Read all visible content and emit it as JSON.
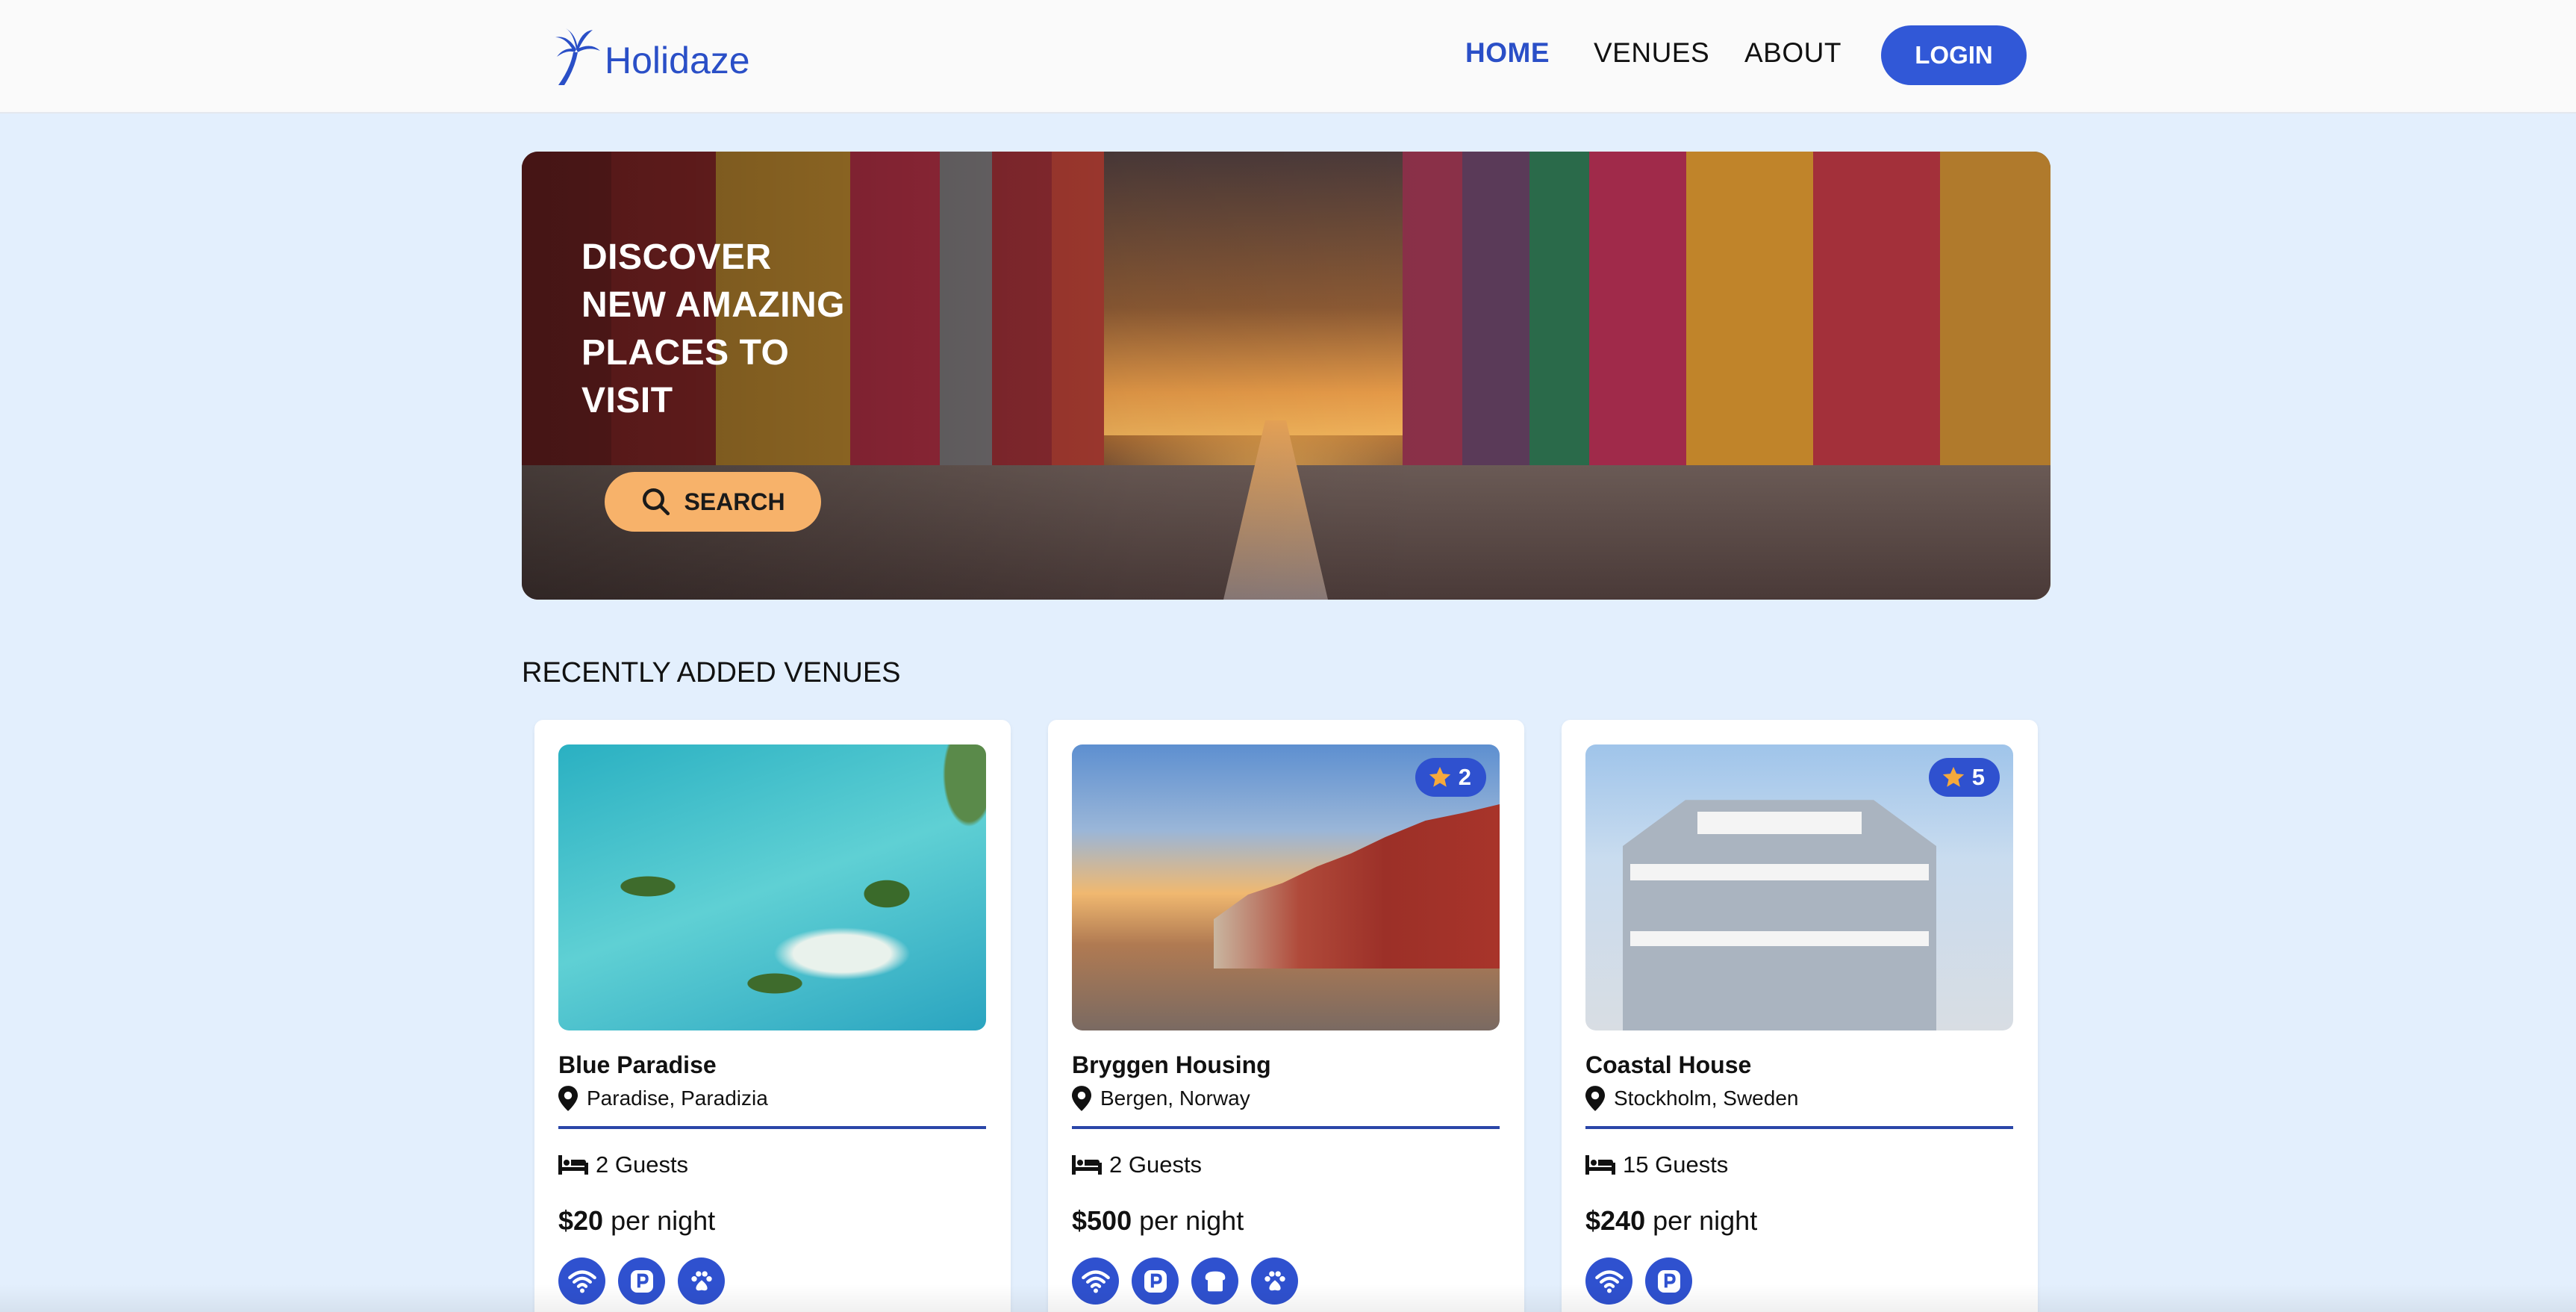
{
  "header": {
    "logo_text": "Holidaze",
    "nav": {
      "home": "HOME",
      "venues": "VENUES",
      "about": "ABOUT"
    },
    "login_label": "LOGIN"
  },
  "hero": {
    "title_lines": [
      "DISCOVER",
      "NEW AMAZING",
      "PLACES TO",
      "VISIT"
    ],
    "search_label": "SEARCH"
  },
  "section_title": "RECENTLY ADDED VENUES",
  "venues": [
    {
      "name": "Blue Paradise",
      "location": "Paradise, Paradizia",
      "guests": "2 Guests",
      "price": "$20",
      "price_suffix": " per night",
      "rating": "",
      "amenities": [
        "wifi-icon",
        "parking-icon",
        "pets-icon"
      ]
    },
    {
      "name": "Bryggen Housing",
      "location": "Bergen, Norway",
      "guests": "2 Guests",
      "price": "$500",
      "price_suffix": " per night",
      "rating": "2",
      "amenities": [
        "wifi-icon",
        "parking-icon",
        "breakfast-icon",
        "pets-icon"
      ]
    },
    {
      "name": "Coastal House",
      "location": "Stockholm, Sweden",
      "guests": "15 Guests",
      "price": "$240",
      "price_suffix": " per night",
      "rating": "5",
      "amenities": [
        "wifi-icon",
        "parking-icon"
      ]
    }
  ],
  "colors": {
    "brand": "#3158d7",
    "accent": "#f7b26a",
    "page_bg": "#e3effd",
    "star": "#f6a93b"
  }
}
